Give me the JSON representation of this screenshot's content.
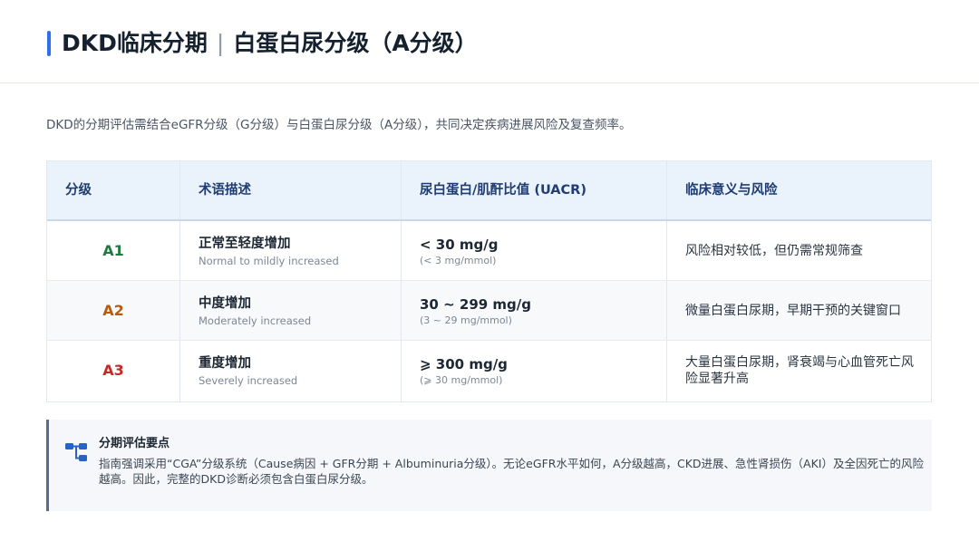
{
  "header": {
    "title_main": "DKD临床分期",
    "separator": "|",
    "title_sub": "白蛋白尿分级（A分级）"
  },
  "intro": "DKD的分期评估需结合eGFR分级（G分级）与白蛋白尿分级（A分级），共同决定疾病进展风险及复查频率。",
  "table": {
    "headers": [
      "分级",
      "术语描述",
      "尿白蛋白/肌酐比值 (UACR)",
      "临床意义与风险"
    ],
    "rows": [
      {
        "grade": "A1",
        "grade_color": "#1f7a3d",
        "term_zh": "正常至轻度增加",
        "term_en": "Normal to mildly increased",
        "uacr": "< 30 mg/g",
        "uacr_sub": "(< 3 mg/mmol)",
        "risk": "风险相对较低，但仍需常规筛查"
      },
      {
        "grade": "A2",
        "grade_color": "#b35c12",
        "term_zh": "中度增加",
        "term_en": "Moderately increased",
        "uacr": "30 ~ 299 mg/g",
        "uacr_sub": "(3 ~ 29 mg/mmol)",
        "risk": "微量白蛋白尿期，早期干预的关键窗口"
      },
      {
        "grade": "A3",
        "grade_color": "#c62828",
        "term_zh": "重度增加",
        "term_en": "Severely increased",
        "uacr": "⩾ 300 mg/g",
        "uacr_sub": "(⩾ 30 mg/mmol)",
        "risk": "大量白蛋白尿期，肾衰竭与心血管死亡风险显著升高"
      }
    ]
  },
  "note": {
    "icon": "flowchart-icon",
    "title": "分期评估要点",
    "body": "指南强调采用“CGA”分级系统（Cause病因 + GFR分期 + Albuminuria分级）。无论eGFR水平如何，A分级越高，CKD进展、急性肾损伤（AKI）及全因死亡的风险越高。因此，完整的DKD诊断必须包含白蛋白尿分级。"
  },
  "colors": {
    "accent": "#2f6fed",
    "header_row_bg": "#eaf2fc",
    "header_text": "#1f3d73",
    "note_border": "#5b6d86",
    "icon": "#2563c9"
  }
}
